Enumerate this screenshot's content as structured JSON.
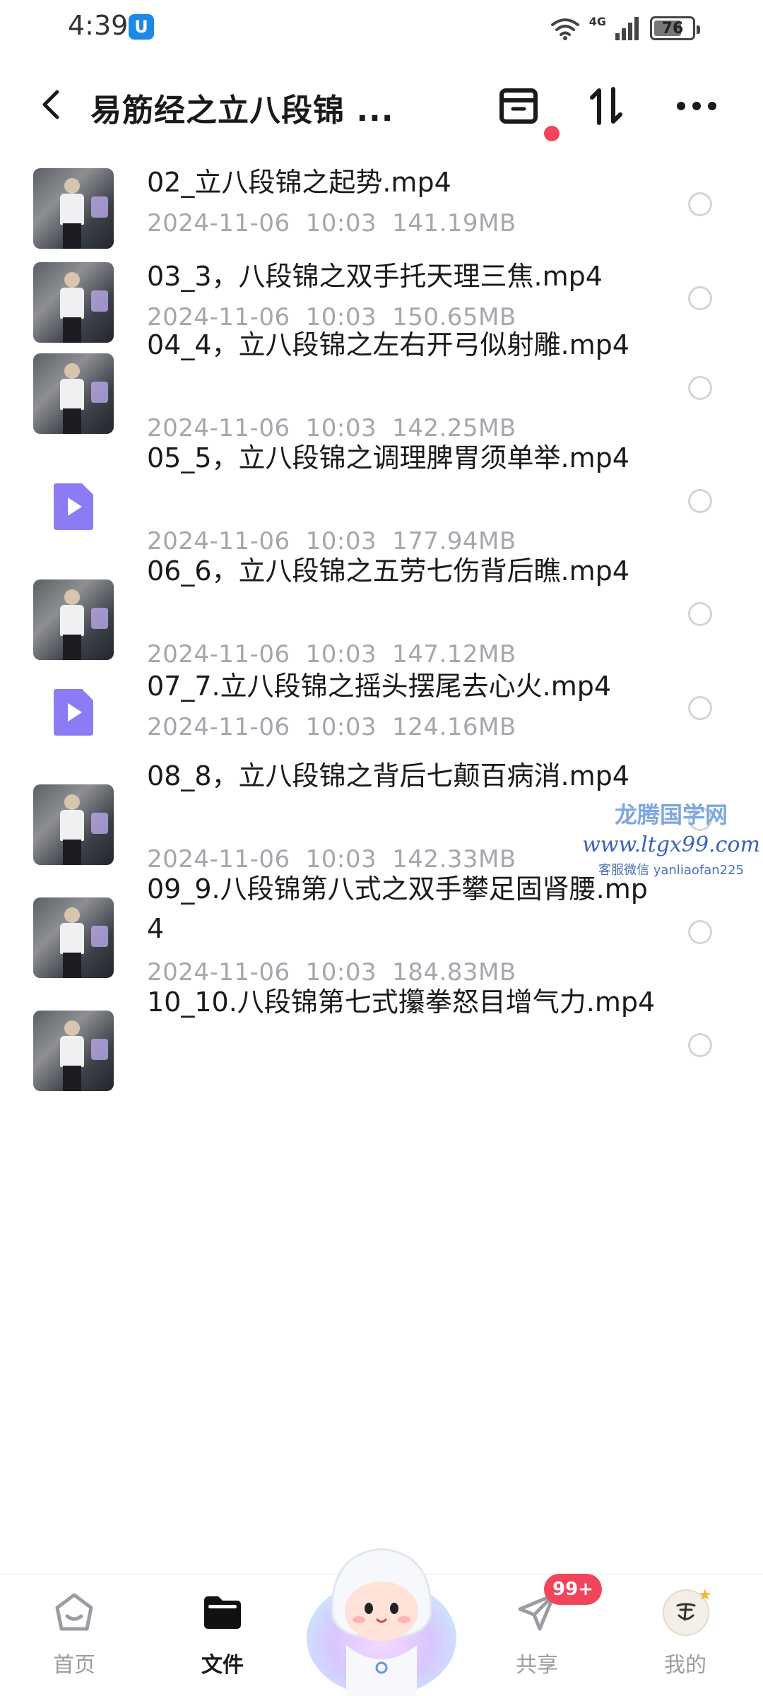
{
  "status_bar": {
    "time": "4:39",
    "app_icon_letter": "U",
    "network": "4G",
    "battery": "76",
    "battery_level": 0.76
  },
  "header": {
    "title": "易筋经之立八段锦 ...",
    "archive_icon": "archive-icon",
    "sort_icon": "sort-icon",
    "more_icon": "more-icon",
    "notification_dot_color": "#f0455a"
  },
  "files": [
    {
      "name": "02_立八段锦之起势.mp4",
      "date": "2024-11-06",
      "time": "10:03",
      "size": "141.19MB",
      "thumb": "photo"
    },
    {
      "name": "03_3，八段锦之双手托天理三焦.mp4",
      "date": "2024-11-06",
      "time": "10:03",
      "size": "150.65MB",
      "thumb": "photo"
    },
    {
      "name": "04_4，立八段锦之左右开弓似射雕.mp4",
      "date": "2024-11-06",
      "time": "10:03",
      "size": "142.25MB",
      "thumb": "photo"
    },
    {
      "name": "05_5，立八段锦之调理脾胃须单举.mp4",
      "date": "2024-11-06",
      "time": "10:03",
      "size": "177.94MB",
      "thumb": "video"
    },
    {
      "name": "06_6，立八段锦之五劳七伤背后瞧.mp4",
      "date": "2024-11-06",
      "time": "10:03",
      "size": "147.12MB",
      "thumb": "photo"
    },
    {
      "name": "07_7.立八段锦之摇头摆尾去心火.mp4",
      "date": "2024-11-06",
      "time": "10:03",
      "size": "124.16MB",
      "thumb": "video"
    },
    {
      "name": "08_8，立八段锦之背后七颠百病消.mp4",
      "date": "2024-11-06",
      "time": "10:03",
      "size": "142.33MB",
      "thumb": "photo"
    },
    {
      "name": "09_9.八段锦第八式之双手攀足固肾腰.mp4",
      "date": "2024-11-06",
      "time": "10:03",
      "size": "184.83MB",
      "thumb": "photo"
    },
    {
      "name": "10_10.八段锦第七式攥拳怒目增气力.mp4",
      "date": "",
      "time": "",
      "size": "",
      "thumb": "photo"
    }
  ],
  "watermark": {
    "title": "龙腾国学网",
    "url": "www.ltgx99.com",
    "contact": "客服微信 yanliaofan225"
  },
  "bottom_nav": {
    "items": [
      {
        "label": "首页",
        "icon": "home-icon",
        "active": false
      },
      {
        "label": "文件",
        "icon": "folder-icon",
        "active": true
      },
      {
        "label": "共享",
        "icon": "share-icon",
        "active": false,
        "badge": "99+"
      },
      {
        "label": "我的",
        "icon": "avatar",
        "active": false
      }
    ]
  },
  "colors": {
    "accent_red": "#f0455a",
    "video_icon": "#8b7cf6",
    "meta_text": "#a4a7ad"
  }
}
